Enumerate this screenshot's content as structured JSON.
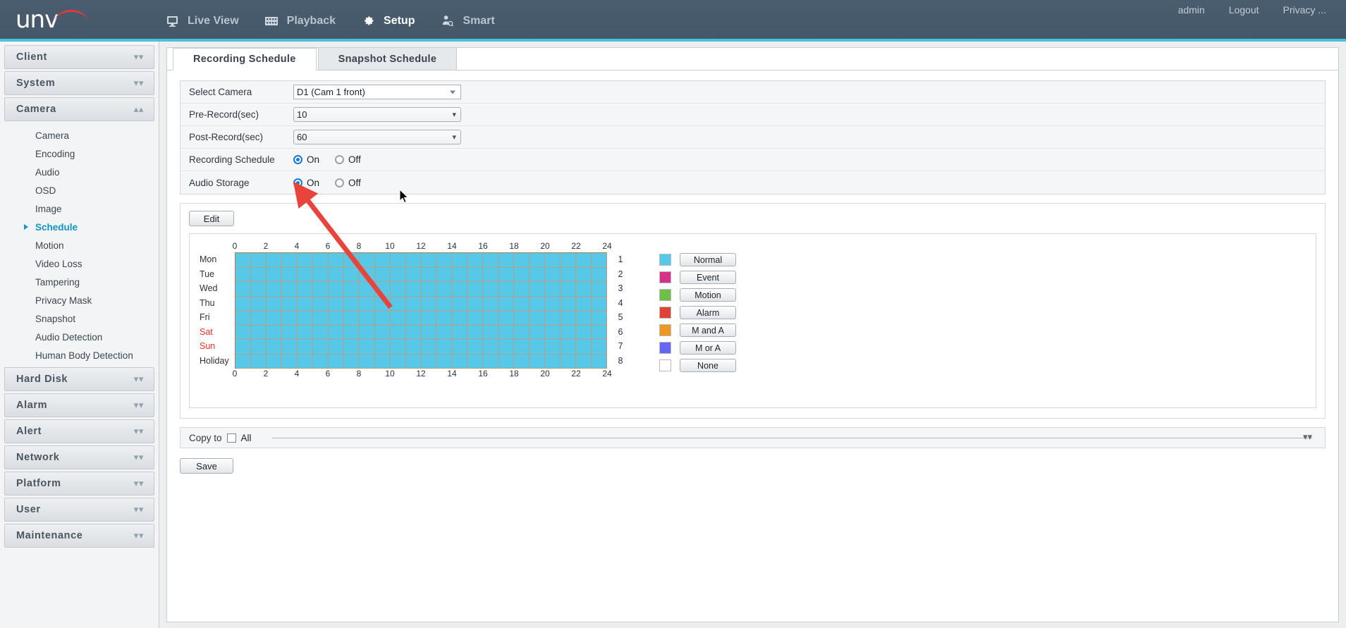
{
  "header": {
    "logo_text": "unv",
    "nav": [
      {
        "label": "Live View",
        "icon": "monitor-icon",
        "active": false
      },
      {
        "label": "Playback",
        "icon": "film-strip-icon",
        "active": false
      },
      {
        "label": "Setup",
        "icon": "gear-icon",
        "active": true
      },
      {
        "label": "Smart",
        "icon": "person-search-icon",
        "active": false
      }
    ],
    "user": "admin",
    "logout": "Logout",
    "privacy": "Privacy ...",
    "accent_color": "#4BC0DC",
    "background_color": "#475A6B"
  },
  "sidebar": {
    "groups": [
      {
        "label": "Client",
        "expanded": false,
        "items": []
      },
      {
        "label": "System",
        "expanded": false,
        "items": []
      },
      {
        "label": "Camera",
        "expanded": true,
        "items": [
          {
            "label": "Camera",
            "active": false
          },
          {
            "label": "Encoding",
            "active": false
          },
          {
            "label": "Audio",
            "active": false
          },
          {
            "label": "OSD",
            "active": false
          },
          {
            "label": "Image",
            "active": false
          },
          {
            "label": "Schedule",
            "active": true
          },
          {
            "label": "Motion",
            "active": false
          },
          {
            "label": "Video Loss",
            "active": false
          },
          {
            "label": "Tampering",
            "active": false
          },
          {
            "label": "Privacy Mask",
            "active": false
          },
          {
            "label": "Snapshot",
            "active": false
          },
          {
            "label": "Audio Detection",
            "active": false
          },
          {
            "label": "Human Body Detection",
            "active": false
          }
        ]
      },
      {
        "label": "Hard Disk",
        "expanded": false,
        "items": []
      },
      {
        "label": "Alarm",
        "expanded": false,
        "items": []
      },
      {
        "label": "Alert",
        "expanded": false,
        "items": []
      },
      {
        "label": "Network",
        "expanded": false,
        "items": []
      },
      {
        "label": "Platform",
        "expanded": false,
        "items": []
      },
      {
        "label": "User",
        "expanded": false,
        "items": []
      },
      {
        "label": "Maintenance",
        "expanded": false,
        "items": []
      }
    ]
  },
  "tabs": [
    {
      "label": "Recording Schedule",
      "active": true
    },
    {
      "label": "Snapshot Schedule",
      "active": false
    }
  ],
  "form": {
    "select_camera": {
      "label": "Select Camera",
      "value": "D1 (Cam 1 front)"
    },
    "pre_record": {
      "label": "Pre-Record(sec)",
      "value": "10"
    },
    "post_record": {
      "label": "Post-Record(sec)",
      "value": "60"
    },
    "recording_schedule": {
      "label": "Recording Schedule",
      "on_label": "On",
      "off_label": "Off",
      "selected": "On"
    },
    "audio_storage": {
      "label": "Audio Storage",
      "on_label": "On",
      "off_label": "Off",
      "selected": "On"
    }
  },
  "schedule": {
    "edit_label": "Edit",
    "hour_ticks": [
      "0",
      "2",
      "4",
      "6",
      "8",
      "10",
      "12",
      "14",
      "16",
      "18",
      "20",
      "22",
      "24"
    ],
    "days": [
      {
        "label": "Mon",
        "weekend": false
      },
      {
        "label": "Tue",
        "weekend": false
      },
      {
        "label": "Wed",
        "weekend": false
      },
      {
        "label": "Thu",
        "weekend": false
      },
      {
        "label": "Fri",
        "weekend": false
      },
      {
        "label": "Sat",
        "weekend": true
      },
      {
        "label": "Sun",
        "weekend": true
      },
      {
        "label": "Holiday",
        "weekend": false
      }
    ],
    "row_numbers": [
      "1",
      "2",
      "3",
      "4",
      "5",
      "6",
      "7",
      "8"
    ],
    "cell_fill_color": "#57C8E8",
    "cell_border_color": "#b99e80",
    "legend": [
      {
        "label": "Normal",
        "color": "#57C8E8"
      },
      {
        "label": "Event",
        "color": "#D53189"
      },
      {
        "label": "Motion",
        "color": "#6EBE4A"
      },
      {
        "label": "Alarm",
        "color": "#E04236"
      },
      {
        "label": "M and A",
        "color": "#EE9822"
      },
      {
        "label": "M or A",
        "color": "#6666F6"
      },
      {
        "label": "None",
        "color": "#FFFFFF"
      }
    ]
  },
  "copy_to": {
    "label": "Copy to",
    "all_label": "All",
    "checked": false
  },
  "save_label": "Save",
  "annotation": {
    "arrow_color": "#E8443C",
    "arrow_target": "audio-storage-on-radio"
  }
}
